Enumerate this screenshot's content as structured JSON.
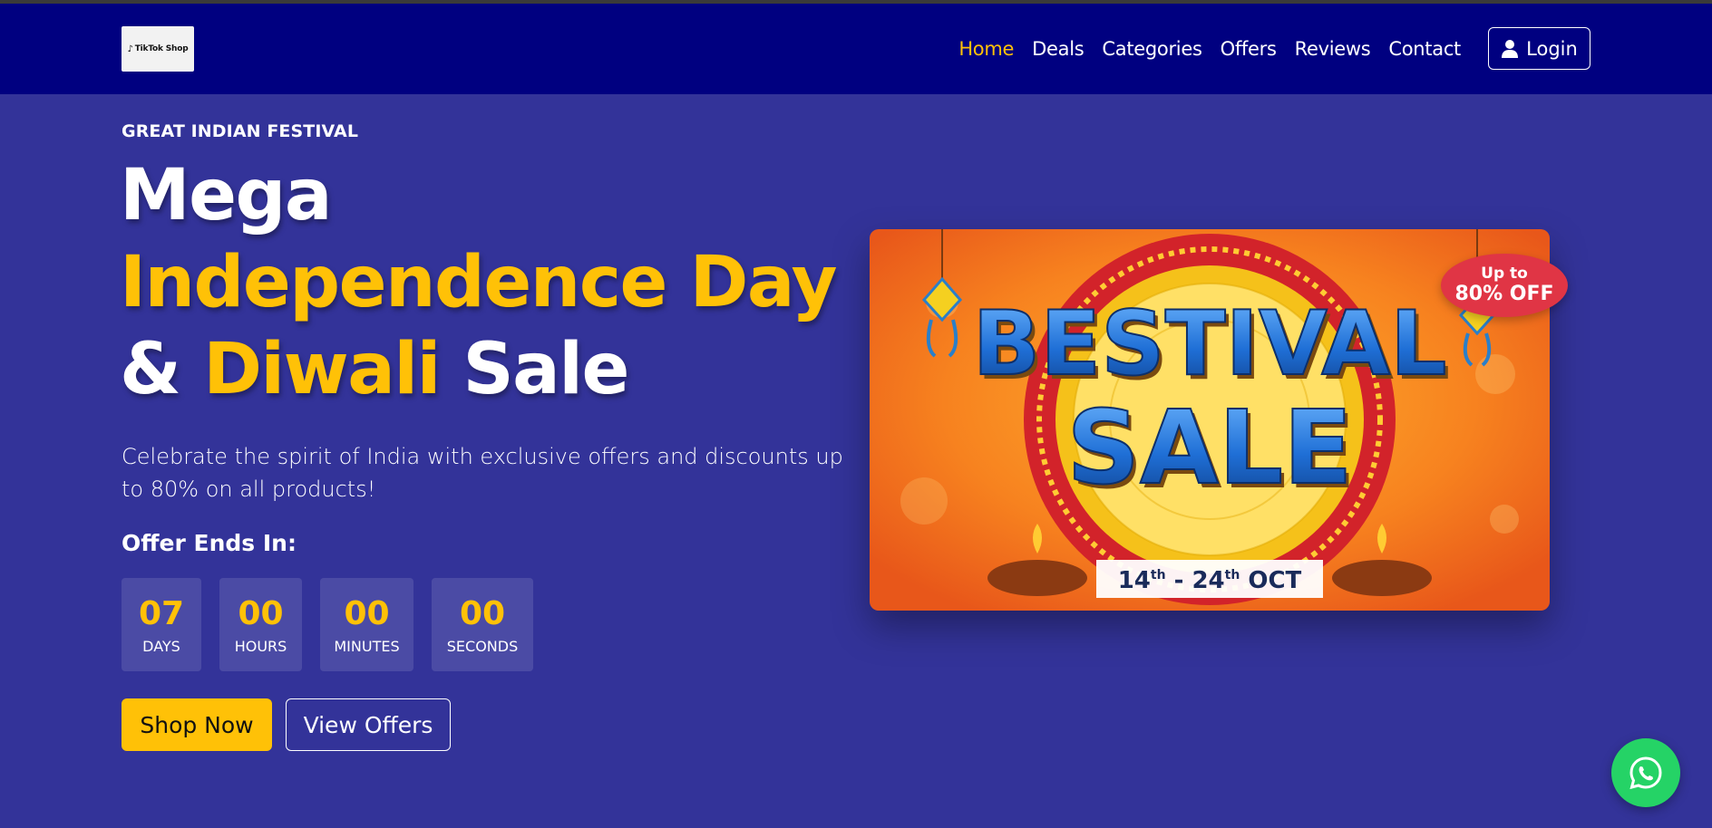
{
  "nav": {
    "logo_text": "TikTok Shop",
    "links": [
      {
        "label": "Home",
        "active": true
      },
      {
        "label": "Deals",
        "active": false
      },
      {
        "label": "Categories",
        "active": false
      },
      {
        "label": "Offers",
        "active": false
      },
      {
        "label": "Reviews",
        "active": false
      },
      {
        "label": "Contact",
        "active": false
      }
    ],
    "login_label": "Login"
  },
  "hero": {
    "eyebrow": "GREAT INDIAN FESTIVAL",
    "headline": {
      "line1": "Mega",
      "line2": "Independence Day",
      "line3_a": "& ",
      "line3_b": "Diwali",
      "line3_c": " Sale"
    },
    "description": "Celebrate the spirit of India with exclusive offers and discounts up to 80% on all products!",
    "countdown_title": "Offer Ends In:",
    "countdown": [
      {
        "value": "07",
        "label": "DAYS"
      },
      {
        "value": "00",
        "label": "HOURS"
      },
      {
        "value": "00",
        "label": "MINUTES"
      },
      {
        "value": "00",
        "label": "SECONDS"
      }
    ],
    "primary_button": "Shop Now",
    "secondary_button": "View Offers"
  },
  "banner": {
    "title_line1": "BESTIVAL",
    "title_line2": "SALE",
    "date_a": "14",
    "date_sup_a": "th",
    "date_b": " - 24",
    "date_sup_b": "th",
    "date_c": " OCT",
    "badge_line1": "Up to",
    "badge_line2": "80% OFF"
  },
  "colors": {
    "navbar": "#000080",
    "page_bg": "#333399",
    "accent": "#ffc107",
    "badge": "#e03545",
    "whatsapp": "#25d366"
  },
  "icons": {
    "login": "user-icon",
    "float": "whatsapp-icon"
  }
}
